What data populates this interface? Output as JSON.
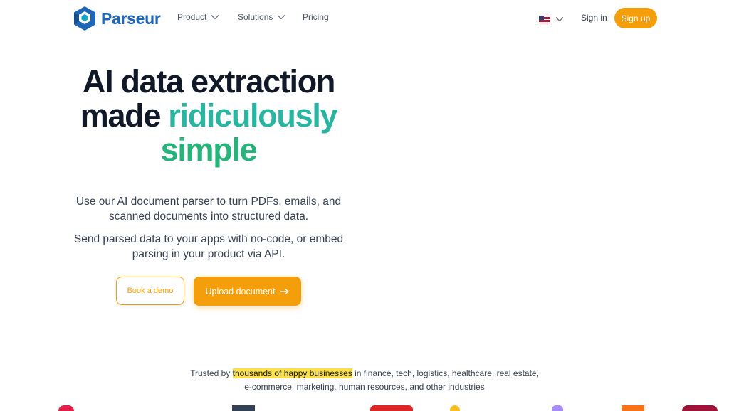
{
  "brand": {
    "name": "Parseur",
    "color": "#1e66b8"
  },
  "nav": {
    "items": [
      {
        "label": "Product",
        "has_dropdown": true
      },
      {
        "label": "Solutions",
        "has_dropdown": true
      },
      {
        "label": "Pricing",
        "has_dropdown": false
      }
    ],
    "language_icon": "us-flag-icon",
    "sign_in": "Sign in",
    "sign_up": "Sign up"
  },
  "hero": {
    "title_part1": "AI data extraction",
    "title_part2": "made",
    "title_accent1": "ridiculously",
    "title_accent2": "simple",
    "subtitle1": "Use our AI document parser to turn PDFs, emails, and scanned documents into structured data.",
    "subtitle2": "Send parsed data to your apps with no-code, or embed parsing in your product via API.",
    "btn_demo": "Book a demo",
    "btn_upload": "Upload document",
    "btn_upload_icon": "arrow-right-icon"
  },
  "trusted": {
    "prefix": "Trusted by",
    "highlight": "thousands of happy businesses",
    "suffix": "in finance, tech, logistics, healthcare, real estate, e-commerce, marketing, human resources, and other industries"
  },
  "colors": {
    "accent": "#f59e0b",
    "teal": "#2bb5a0",
    "green": "#27b47a",
    "highlight": "#fde047"
  }
}
